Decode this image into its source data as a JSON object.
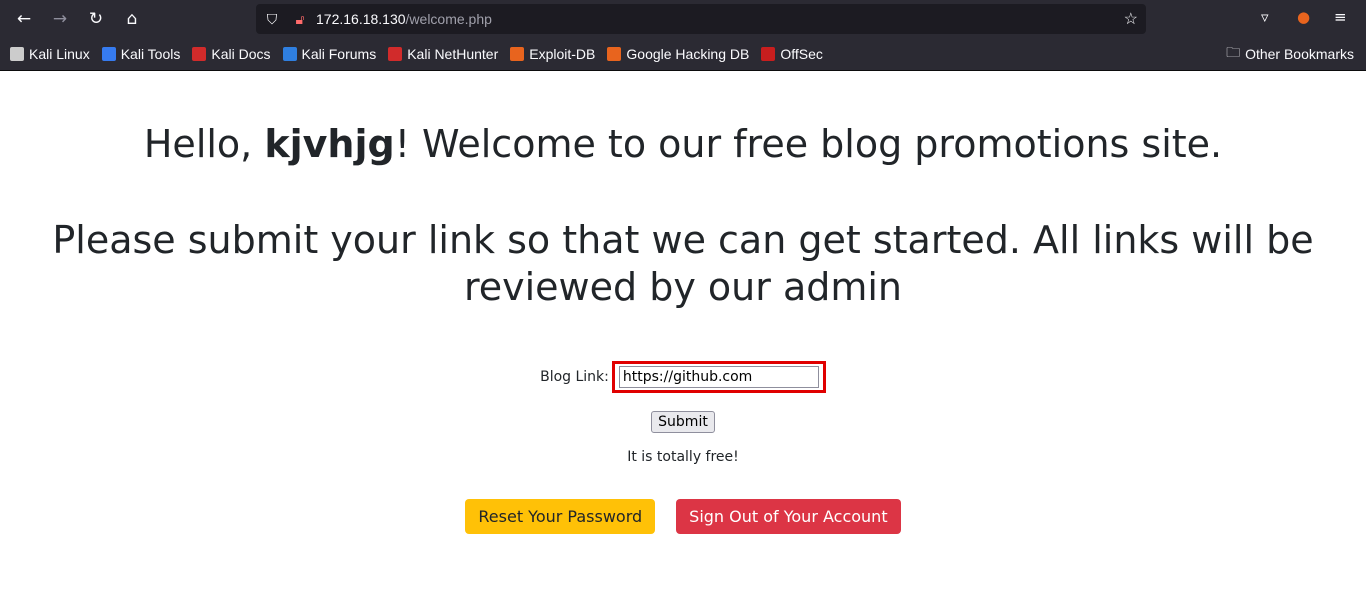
{
  "browser": {
    "url_host": "172.16.18.130",
    "url_path": "/welcome.php",
    "bookmarks": [
      {
        "label": "Kali Linux",
        "icon": "kali-dragon-icon",
        "color": "#cccccc"
      },
      {
        "label": "Kali Tools",
        "icon": "kali-tools-icon",
        "color": "#367bf0"
      },
      {
        "label": "Kali Docs",
        "icon": "kali-docs-icon",
        "color": "#d12b2b"
      },
      {
        "label": "Kali Forums",
        "icon": "kali-forums-icon",
        "color": "#2f7fe0"
      },
      {
        "label": "Kali NetHunter",
        "icon": "nethunter-icon",
        "color": "#d12b2b"
      },
      {
        "label": "Exploit-DB",
        "icon": "exploit-db-icon",
        "color": "#e8641e"
      },
      {
        "label": "Google Hacking DB",
        "icon": "ghdb-icon",
        "color": "#e8641e"
      },
      {
        "label": "OffSec",
        "icon": "offsec-icon",
        "color": "#c81e1e"
      }
    ],
    "other_bookmarks": "Other Bookmarks"
  },
  "page": {
    "greeting_prefix": "Hello, ",
    "username": "kjvhjg",
    "greeting_suffix": "! Welcome to our free blog promotions site.",
    "subheading": "Please submit your link so that we can get started. All links will be reviewed by our admin",
    "form": {
      "label": "Blog Link:",
      "value": "https://github.com",
      "submit": "Submit"
    },
    "note": "It is totally free!",
    "reset_button": "Reset Your Password",
    "signout_button": "Sign Out of Your Account"
  }
}
